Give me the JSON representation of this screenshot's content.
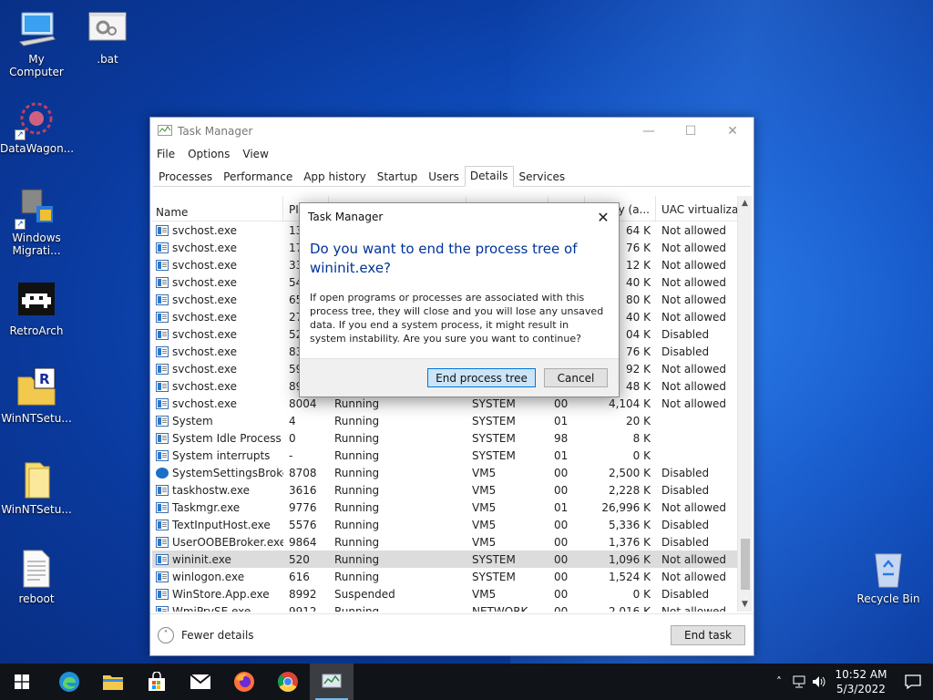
{
  "desktop": {
    "icons": [
      {
        "label": "My Computer"
      },
      {
        "label": ".bat"
      },
      {
        "label": "DataWagon..."
      },
      {
        "label": "Windows Migrati..."
      },
      {
        "label": "RetroArch"
      },
      {
        "label": "WinNTSetu..."
      },
      {
        "label": "WinNTSetu..."
      },
      {
        "label": "reboot"
      },
      {
        "label": "Recycle Bin"
      }
    ]
  },
  "task_manager": {
    "title": "Task Manager",
    "menu": [
      "File",
      "Options",
      "View"
    ],
    "tabs": [
      "Processes",
      "Performance",
      "App history",
      "Startup",
      "Users",
      "Details",
      "Services"
    ],
    "active_tab": "Details",
    "columns": [
      "Name",
      "PI",
      "",
      "",
      "",
      "y (a...",
      "UAC virtualizat..."
    ],
    "rows": [
      {
        "name": "svchost.exe",
        "pid": "13",
        "status": "",
        "user": "",
        "cpu": "",
        "mem": "64 K",
        "uac": "Not allowed"
      },
      {
        "name": "svchost.exe",
        "pid": "17",
        "status": "",
        "user": "",
        "cpu": "",
        "mem": "76 K",
        "uac": "Not allowed"
      },
      {
        "name": "svchost.exe",
        "pid": "33",
        "status": "",
        "user": "",
        "cpu": "",
        "mem": "12 K",
        "uac": "Not allowed"
      },
      {
        "name": "svchost.exe",
        "pid": "54",
        "status": "",
        "user": "",
        "cpu": "",
        "mem": "40 K",
        "uac": "Not allowed"
      },
      {
        "name": "svchost.exe",
        "pid": "65",
        "status": "",
        "user": "",
        "cpu": "",
        "mem": "80 K",
        "uac": "Not allowed"
      },
      {
        "name": "svchost.exe",
        "pid": "27",
        "status": "",
        "user": "",
        "cpu": "",
        "mem": "40 K",
        "uac": "Not allowed"
      },
      {
        "name": "svchost.exe",
        "pid": "52",
        "status": "",
        "user": "",
        "cpu": "",
        "mem": "04 K",
        "uac": "Disabled"
      },
      {
        "name": "svchost.exe",
        "pid": "83",
        "status": "",
        "user": "",
        "cpu": "",
        "mem": "76 K",
        "uac": "Disabled"
      },
      {
        "name": "svchost.exe",
        "pid": "59",
        "status": "",
        "user": "",
        "cpu": "",
        "mem": "92 K",
        "uac": "Not allowed"
      },
      {
        "name": "svchost.exe",
        "pid": "89",
        "status": "",
        "user": "",
        "cpu": "",
        "mem": "48 K",
        "uac": "Not allowed"
      },
      {
        "name": "svchost.exe",
        "pid": "8004",
        "status": "Running",
        "user": "SYSTEM",
        "cpu": "00",
        "mem": "4,104 K",
        "uac": "Not allowed"
      },
      {
        "name": "System",
        "pid": "4",
        "status": "Running",
        "user": "SYSTEM",
        "cpu": "01",
        "mem": "20 K",
        "uac": ""
      },
      {
        "name": "System Idle Process",
        "pid": "0",
        "status": "Running",
        "user": "SYSTEM",
        "cpu": "98",
        "mem": "8 K",
        "uac": ""
      },
      {
        "name": "System interrupts",
        "pid": "-",
        "status": "Running",
        "user": "SYSTEM",
        "cpu": "01",
        "mem": "0 K",
        "uac": ""
      },
      {
        "name": "SystemSettingsBroke...",
        "pid": "8708",
        "status": "Running",
        "user": "VM5",
        "cpu": "00",
        "mem": "2,500 K",
        "uac": "Disabled",
        "icon": "gear"
      },
      {
        "name": "taskhostw.exe",
        "pid": "3616",
        "status": "Running",
        "user": "VM5",
        "cpu": "00",
        "mem": "2,228 K",
        "uac": "Disabled"
      },
      {
        "name": "Taskmgr.exe",
        "pid": "9776",
        "status": "Running",
        "user": "VM5",
        "cpu": "01",
        "mem": "26,996 K",
        "uac": "Not allowed"
      },
      {
        "name": "TextInputHost.exe",
        "pid": "5576",
        "status": "Running",
        "user": "VM5",
        "cpu": "00",
        "mem": "5,336 K",
        "uac": "Disabled"
      },
      {
        "name": "UserOOBEBroker.exe",
        "pid": "9864",
        "status": "Running",
        "user": "VM5",
        "cpu": "00",
        "mem": "1,376 K",
        "uac": "Disabled"
      },
      {
        "name": "wininit.exe",
        "pid": "520",
        "status": "Running",
        "user": "SYSTEM",
        "cpu": "00",
        "mem": "1,096 K",
        "uac": "Not allowed",
        "selected": true
      },
      {
        "name": "winlogon.exe",
        "pid": "616",
        "status": "Running",
        "user": "SYSTEM",
        "cpu": "00",
        "mem": "1,524 K",
        "uac": "Not allowed"
      },
      {
        "name": "WinStore.App.exe",
        "pid": "8992",
        "status": "Suspended",
        "user": "VM5",
        "cpu": "00",
        "mem": "0 K",
        "uac": "Disabled"
      },
      {
        "name": "WmiPrvSE.exe",
        "pid": "9912",
        "status": "Running",
        "user": "NETWORK...",
        "cpu": "00",
        "mem": "2,016 K",
        "uac": "Not allowed"
      }
    ],
    "fewer_details": "Fewer details",
    "end_task": "End task"
  },
  "dialog": {
    "title": "Task Manager",
    "heading": "Do you want to end the process tree of wininit.exe?",
    "text": "If open programs or processes are associated with this process tree, they will close and you will lose any unsaved data. If you end a system process, it might result in system instability. Are you sure you want to continue?",
    "confirm_label": "End process tree",
    "cancel_label": "Cancel"
  },
  "taskbar": {
    "time": "10:52 AM",
    "date": "5/3/2022"
  }
}
